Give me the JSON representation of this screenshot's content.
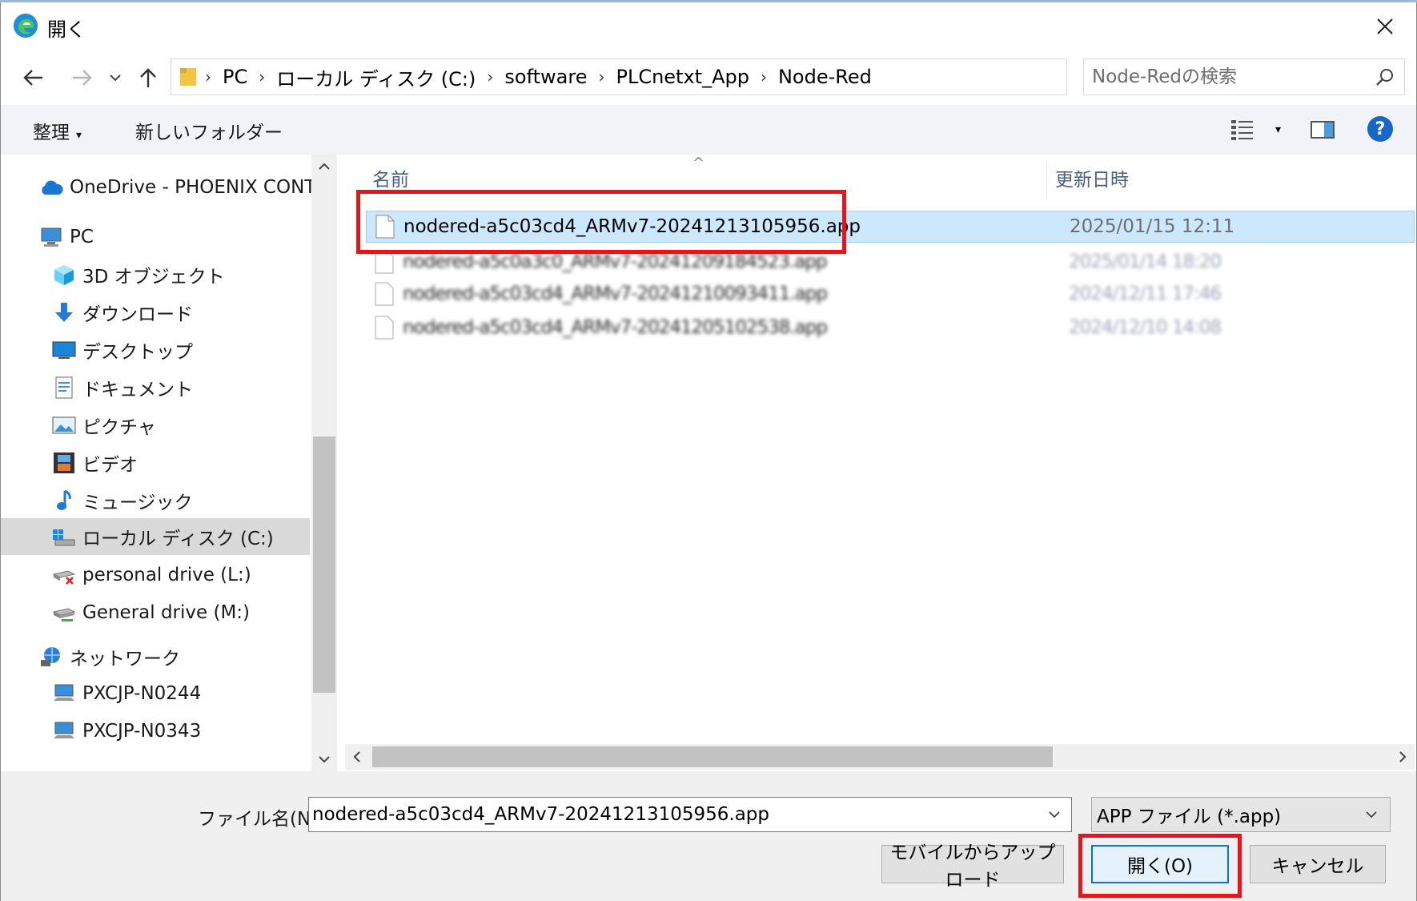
{
  "window": {
    "title": "開く",
    "close_symbol": "✕"
  },
  "address": {
    "crumbs": [
      "PC",
      "ローカル ディスク (C:)",
      "software",
      "PLCnetxt_App",
      "Node-Red"
    ],
    "separator": "›"
  },
  "search": {
    "placeholder": "Node-Redの検索"
  },
  "toolbar": {
    "organize_label": "整理",
    "organize_arrow": "▾",
    "new_folder_label": "新しいフォルダー",
    "view_arrow": "▾",
    "help_label": "?"
  },
  "navpane": {
    "items": [
      {
        "label": "OneDrive - PHOENIX CONTA",
        "icon": "cloud-icon"
      },
      {
        "label": "PC",
        "icon": "computer-icon"
      },
      {
        "label": "3D オブジェクト",
        "icon": "cube-icon"
      },
      {
        "label": "ダウンロード",
        "icon": "download-arrow-icon"
      },
      {
        "label": "デスクトップ",
        "icon": "desktop-icon"
      },
      {
        "label": "ドキュメント",
        "icon": "document-icon"
      },
      {
        "label": "ピクチャ",
        "icon": "picture-icon"
      },
      {
        "label": "ビデオ",
        "icon": "video-icon"
      },
      {
        "label": "ミュージック",
        "icon": "music-note-icon"
      },
      {
        "label": "ローカル ディスク (C:)",
        "icon": "local-disk-icon"
      },
      {
        "label": "personal drive (L:)",
        "icon": "disconnected-drive-icon"
      },
      {
        "label": "General drive (M:)",
        "icon": "network-drive-icon"
      },
      {
        "label": "ネットワーク",
        "icon": "network-icon"
      },
      {
        "label": "PXCJP-N0244",
        "icon": "network-computer-icon"
      },
      {
        "label": "PXCJP-N0343",
        "icon": "network-computer-icon"
      }
    ],
    "selected_index": 9
  },
  "filelist": {
    "columns": {
      "name": "名前",
      "date": "更新日時"
    },
    "sort_caret": "^",
    "files": [
      {
        "name": "nodered-a5c03cd4_ARMv7-20241213105956.app",
        "date": "2025/01/15 12:11",
        "selected": true
      },
      {
        "name": "nodered-a5c0a3c0_ARMv7-20241209184523.app",
        "date": "2025/01/14 18:20",
        "blurred": true
      },
      {
        "name": "nodered-a5c03cd4_ARMv7-20241210093411.app",
        "date": "2024/12/11 17:46",
        "blurred": true
      },
      {
        "name": "nodered-a5c03cd4_ARMv7-20241205102538.app",
        "date": "2024/12/10 14:08",
        "blurred": true
      }
    ]
  },
  "footer": {
    "filename_label": "ファイル名(N):",
    "filename_value": "nodered-a5c03cd4_ARMv7-20241213105956.app",
    "filetype_value": "APP ファイル (*.app)",
    "upload_button": "モバイルからアップロード",
    "open_button": "開く(O)",
    "cancel_button": "キャンセル"
  },
  "colors": {
    "accent": "#0078d7",
    "selection": "#cce8ff",
    "highlight": "#e8141b"
  }
}
